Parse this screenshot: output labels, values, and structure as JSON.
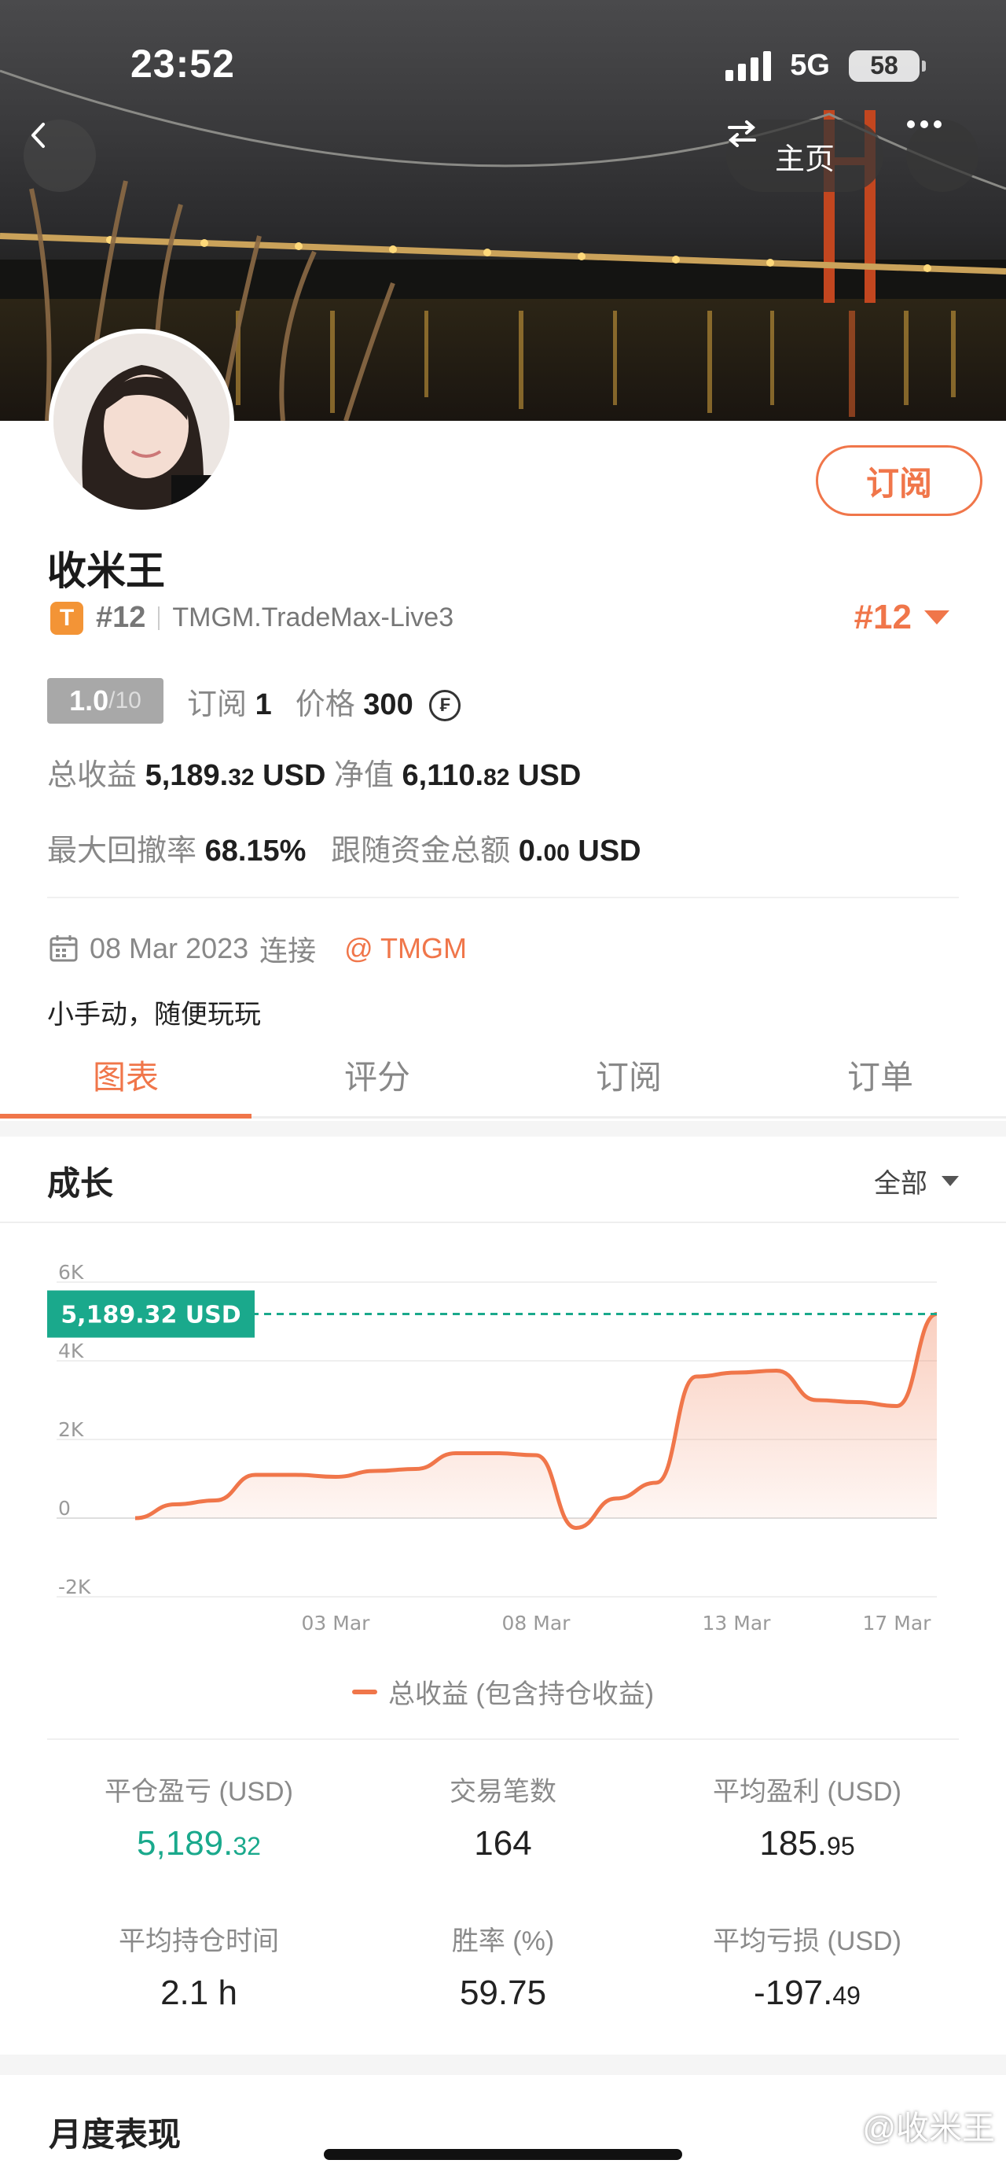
{
  "status_bar": {
    "time": "23:52",
    "network": "5G",
    "battery": "58"
  },
  "header": {
    "home_label": "主页"
  },
  "profile": {
    "subscribe_label": "订阅",
    "name": "收米王",
    "badge_letter": "T",
    "rank_small": "#12",
    "server": "TMGM.TradeMax-Live3",
    "rank_big": "#12",
    "rating_main": "1.0",
    "rating_total": "/10",
    "subscriptions_label": "订阅",
    "subscriptions_value": "1",
    "price_label": "价格",
    "price_value": "300",
    "coin_symbol": "₣",
    "total_profit_label": "总收益",
    "total_profit_int": "5,189.",
    "total_profit_dec": "32",
    "total_profit_unit": "USD",
    "equity_label": "净值",
    "equity_int": "6,110.",
    "equity_dec": "82",
    "equity_unit": "USD",
    "drawdown_label": "最大回撤率",
    "drawdown_value": "68.15%",
    "follow_label": "跟随资金总额",
    "follow_int": "0.",
    "follow_dec": "00",
    "follow_unit": "USD",
    "join_date": "08 Mar 2023",
    "join_label": "连接",
    "broker": "@ TMGM",
    "bio": "小手动，随便玩玩"
  },
  "tabs": [
    {
      "label": "图表",
      "active": true
    },
    {
      "label": "评分",
      "active": false
    },
    {
      "label": "订阅",
      "active": false
    },
    {
      "label": "订单",
      "active": false
    }
  ],
  "growth": {
    "title": "成长",
    "filter": "全部"
  },
  "chart_data": {
    "type": "area",
    "y_tick_labels": [
      "6K",
      "4K",
      "2K",
      "0",
      "-2K"
    ],
    "x_tick_labels": [
      "03 Mar",
      "08 Mar",
      "13 Mar",
      "17 Mar"
    ],
    "ylim": [
      -2000,
      6000
    ],
    "current_label": "5,189.32 USD",
    "current_value": 5189.32,
    "legend": "总收益 (包含持仓收益)",
    "accent_color": "#f0764a",
    "marker_color": "#1aa98c",
    "series": [
      {
        "name": "总收益 (包含持仓收益)",
        "x": [
          "26 Feb",
          "27 Feb",
          "28 Feb",
          "01 Mar",
          "02 Mar",
          "03 Mar",
          "04 Mar",
          "05 Mar",
          "06 Mar",
          "07 Mar",
          "08 Mar",
          "09 Mar",
          "10 Mar",
          "11 Mar",
          "12 Mar",
          "13 Mar",
          "14 Mar",
          "15 Mar",
          "16 Mar",
          "17 Mar",
          "18 Mar"
        ],
        "values": [
          0,
          350,
          450,
          1100,
          1100,
          1050,
          1200,
          1250,
          1650,
          1650,
          1600,
          -250,
          500,
          900,
          3600,
          3700,
          3750,
          3000,
          2950,
          2850,
          5189.32
        ]
      }
    ]
  },
  "stats": [
    {
      "label": "平仓盈亏 (USD)",
      "int": "5,189.",
      "dec": "32",
      "green": true
    },
    {
      "label": "交易笔数",
      "int": "164",
      "dec": "",
      "green": false
    },
    {
      "label": "平均盈利 (USD)",
      "int": "185.",
      "dec": "95",
      "green": false
    },
    {
      "label": "平均持仓时间",
      "int": "2.1 h",
      "dec": "",
      "green": false
    },
    {
      "label": "胜率 (%)",
      "int": "59.75",
      "dec": "",
      "green": false
    },
    {
      "label": "平均亏损 (USD)",
      "int": "-197.",
      "dec": "49",
      "green": false
    }
  ],
  "monthly_title": "月度表现",
  "watermark": "@收米王"
}
